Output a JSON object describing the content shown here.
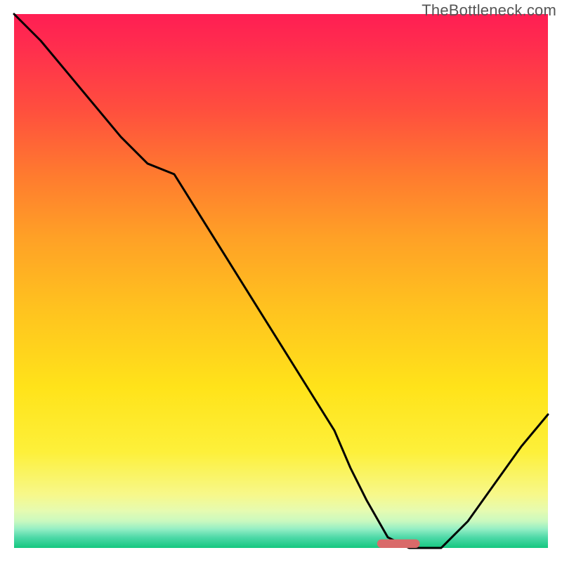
{
  "watermark": "TheBottleneck.com",
  "chart_data": {
    "type": "line",
    "title": "",
    "xlabel": "",
    "ylabel": "",
    "xlim": [
      0,
      100
    ],
    "ylim": [
      0,
      100
    ],
    "grid": false,
    "x": [
      0,
      5,
      10,
      15,
      20,
      25,
      30,
      35,
      40,
      45,
      50,
      55,
      60,
      63,
      66,
      70,
      74,
      78,
      80,
      85,
      90,
      95,
      100
    ],
    "values": [
      100,
      95,
      89,
      83,
      77,
      72,
      70,
      62,
      54,
      46,
      38,
      30,
      22,
      15,
      9,
      2,
      0,
      0,
      0,
      5,
      12,
      19,
      25
    ],
    "marker": {
      "x_center": 72,
      "y_center": 0.8,
      "width": 8,
      "height": 1.6
    },
    "gradient_stops": [
      {
        "pos": 0.0,
        "color": "#ff1e53"
      },
      {
        "pos": 0.5,
        "color": "#ffc21f"
      },
      {
        "pos": 0.85,
        "color": "#fdf03a"
      },
      {
        "pos": 1.0,
        "color": "#14c77f"
      }
    ]
  }
}
